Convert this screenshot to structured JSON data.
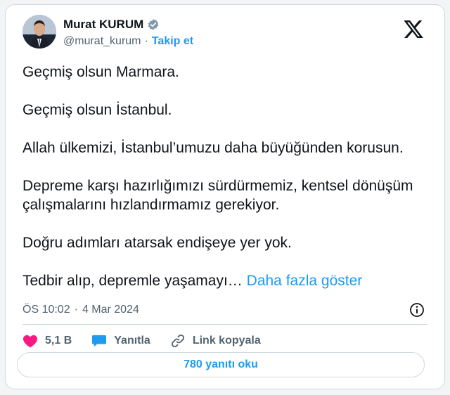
{
  "author": {
    "display_name": "Murat KURUM",
    "handle": "@murat_kurum",
    "separator": "·",
    "follow_label": "Takip et"
  },
  "tweet": {
    "paragraphs": [
      "Geçmiş olsun Marmara.",
      "Geçmiş olsun İstanbul.",
      "Allah ülkemizi, İstanbul’umuzu daha büyüğünden korusun.",
      "Depreme karşı hazırlığımızı sürdürmemiz, kentsel dönüşüm çalışmalarını hızlandırmamız gerekiyor.",
      "Doğru adımları atarsak endişeye yer yok."
    ],
    "truncated_text": "Tedbir alıp, depremle yaşamayı…",
    "show_more_label": "Daha fazla göster"
  },
  "meta": {
    "time": "ÖS 10:02",
    "separator": "·",
    "date": "4 Mar 2024"
  },
  "actions": {
    "likes": "5,1 B",
    "reply_label": "Yanıtla",
    "copy_link_label": "Link kopyala"
  },
  "read_replies_label": "780 yanıtı oku",
  "colors": {
    "accent": "#1d9bf0",
    "like": "#f91880",
    "text": "#0f1419",
    "secondary": "#536471",
    "border": "#cfd9de"
  },
  "icons": [
    "verified-badge-icon",
    "x-logo-icon",
    "info-icon",
    "heart-icon",
    "reply-bubble-icon",
    "link-icon"
  ]
}
